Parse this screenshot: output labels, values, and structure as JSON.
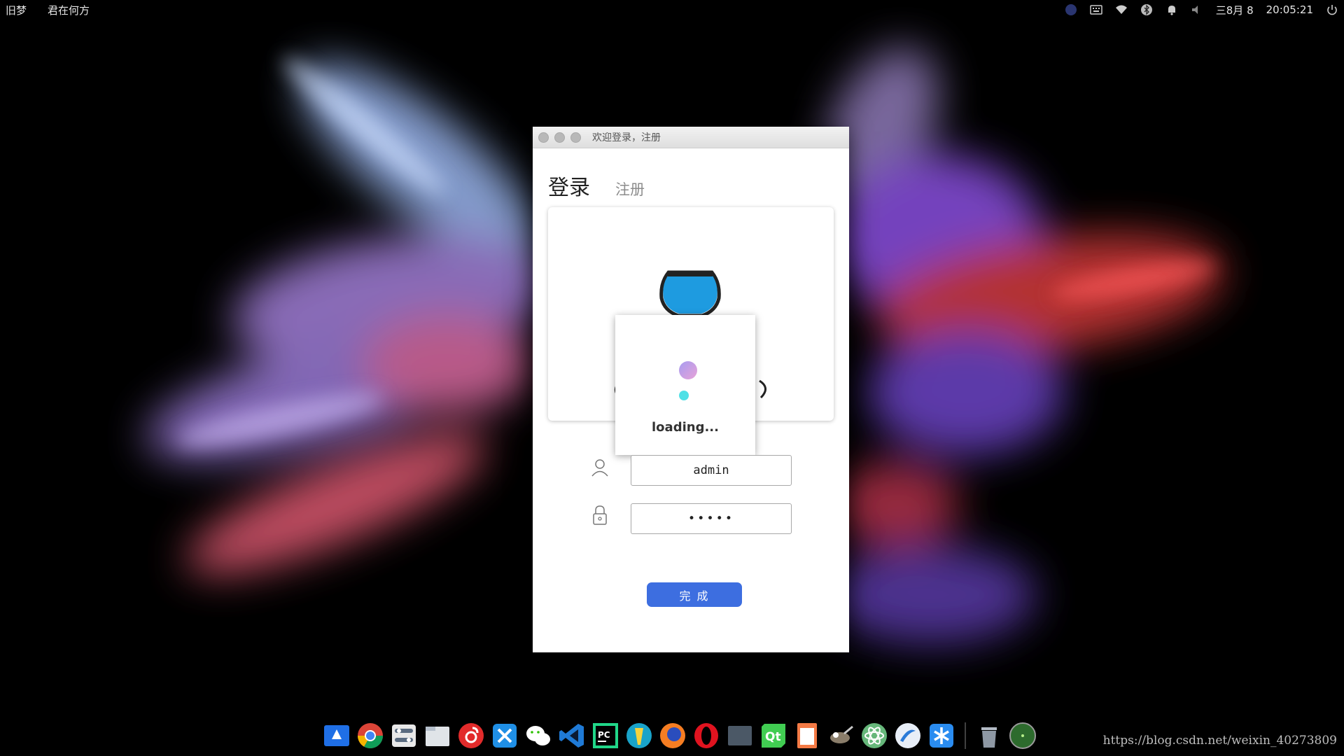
{
  "top_panel": {
    "left_items": [
      "旧梦",
      "君在何方"
    ],
    "date": "三8月 8",
    "time": "20:05:21"
  },
  "window": {
    "title": "欢迎登录，注册",
    "tabs": {
      "login": "登录",
      "register": "注册"
    },
    "loading_text": "loading...",
    "username_value": "admin",
    "password_value": "•••••",
    "submit_label": "完 成"
  },
  "dock": {
    "icons": [
      "launcher-icon",
      "chrome-icon",
      "settings-icon",
      "files-icon",
      "netease-music-icon",
      "xmind-icon",
      "wechat-icon",
      "vscode-icon",
      "pycharm-icon",
      "tool-icon",
      "firefox-icon",
      "opera-icon",
      "terminal-icon",
      "qt-icon",
      "document-icon",
      "gimp-icon",
      "atom-icon",
      "deepin-icon",
      "xmind-blue-icon",
      "trash-icon",
      "system-icon"
    ]
  },
  "watermark": "https://blog.csdn.net/weixin_40273809",
  "colors": {
    "accent_blue": "#3d6ee0",
    "fishbowl_water": "#1e9be0"
  }
}
